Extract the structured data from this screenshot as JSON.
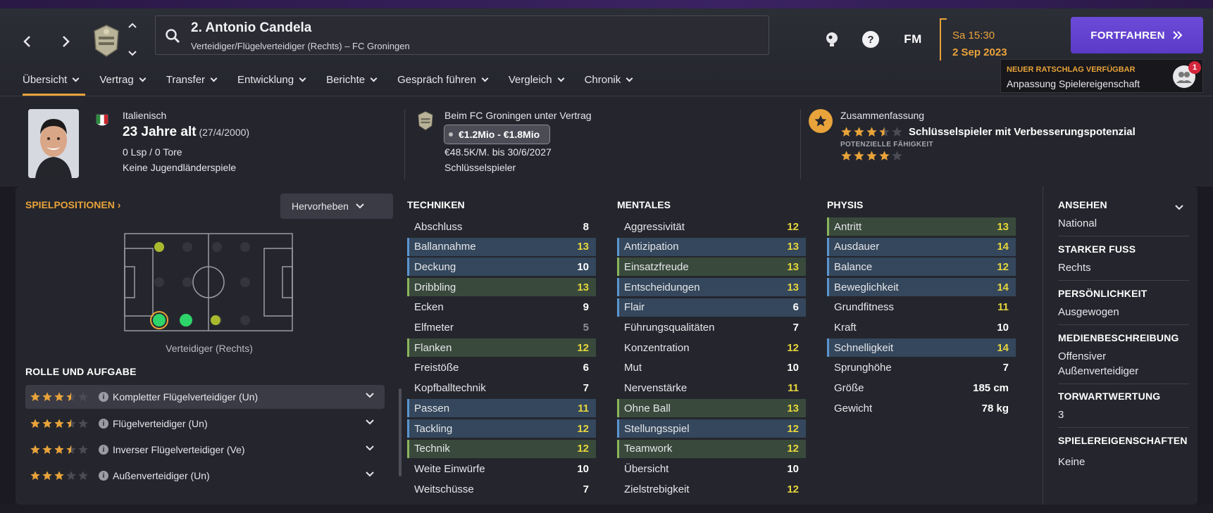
{
  "header": {
    "player_title": "2. Antonio Candela",
    "player_subtitle": "Verteidiger/Flügelverteidiger (Rechts) – FC Groningen",
    "fm_logo": "FM",
    "date_time": "Sa 15:30",
    "date_day": "2 Sep 2023",
    "continue_label": "FORTFAHREN",
    "accent_color": "#e8a33a",
    "button_color": "#6c4bd8"
  },
  "tabs": [
    {
      "label": "Übersicht"
    },
    {
      "label": "Vertrag"
    },
    {
      "label": "Transfer"
    },
    {
      "label": "Entwicklung"
    },
    {
      "label": "Berichte"
    },
    {
      "label": "Gespräch führen"
    },
    {
      "label": "Vergleich"
    },
    {
      "label": "Chronik"
    }
  ],
  "advice": {
    "title": "NEUER RATSCHLAG VERFÜGBAR",
    "text": "Anpassung Spielereigenschaft",
    "badge_count": "1"
  },
  "summary": {
    "nationality": "Italienisch",
    "age": "23 Jahre alt",
    "birthdate": "(27/4/2000)",
    "caps": "0 Lsp / 0 Tore",
    "youth_caps": "Keine Jugendländerspiele",
    "contract_club": "Beim FC Groningen unter Vertrag",
    "value_range": "€1.2Mio - €1.8Mio",
    "wage": "€48.5K/M. bis 30/6/2027",
    "squad_status": "Schlüsselspieler",
    "summary_label": "Zusammenfassung",
    "summary_text": "Schlüsselspieler mit Verbesserungspotenzial",
    "current_ability_stars": 3.5,
    "potential_label": "POTENZIELLE FÄHIGKEIT",
    "potential_stars": 4
  },
  "positions": {
    "title": "SPIELPOSITIONEN",
    "highlight_label": "Hervorheben",
    "position_label": "Verteidiger (Rechts)"
  },
  "roles": {
    "title": "ROLLE UND AUFGABE",
    "items": [
      {
        "stars": 3.5,
        "name": "Kompletter Flügelverteidiger (Un)"
      },
      {
        "stars": 3.5,
        "name": "Flügelverteidiger (Un)"
      },
      {
        "stars": 3.5,
        "name": "Inverser Flügelverteidiger (Ve)"
      },
      {
        "stars": 3,
        "name": "Außenverteidiger (Un)"
      }
    ]
  },
  "technical": {
    "title": "TECHNIKEN",
    "rows": [
      {
        "name": "Abschluss",
        "value": "8"
      },
      {
        "name": "Ballannahme",
        "value": "13"
      },
      {
        "name": "Deckung",
        "value": "10"
      },
      {
        "name": "Dribbling",
        "value": "13"
      },
      {
        "name": "Ecken",
        "value": "9"
      },
      {
        "name": "Elfmeter",
        "value": "5"
      },
      {
        "name": "Flanken",
        "value": "12"
      },
      {
        "name": "Freistöße",
        "value": "6"
      },
      {
        "name": "Kopfballtechnik",
        "value": "7"
      },
      {
        "name": "Passen",
        "value": "11"
      },
      {
        "name": "Tackling",
        "value": "12"
      },
      {
        "name": "Technik",
        "value": "12"
      },
      {
        "name": "Weite Einwürfe",
        "value": "10"
      },
      {
        "name": "Weitschüsse",
        "value": "7"
      }
    ]
  },
  "mental": {
    "title": "MENTALES",
    "rows": [
      {
        "name": "Aggressivität",
        "value": "12"
      },
      {
        "name": "Antizipation",
        "value": "13"
      },
      {
        "name": "Einsatzfreude",
        "value": "13"
      },
      {
        "name": "Entscheidungen",
        "value": "13"
      },
      {
        "name": "Flair",
        "value": "6"
      },
      {
        "name": "Führungsqualitäten",
        "value": "7"
      },
      {
        "name": "Konzentration",
        "value": "12"
      },
      {
        "name": "Mut",
        "value": "10"
      },
      {
        "name": "Nervenstärke",
        "value": "11"
      },
      {
        "name": "Ohne Ball",
        "value": "13"
      },
      {
        "name": "Stellungsspiel",
        "value": "12"
      },
      {
        "name": "Teamwork",
        "value": "12"
      },
      {
        "name": "Übersicht",
        "value": "10"
      },
      {
        "name": "Zielstrebigkeit",
        "value": "12"
      }
    ]
  },
  "physical": {
    "title": "PHYSIS",
    "rows": [
      {
        "name": "Antritt",
        "value": "13"
      },
      {
        "name": "Ausdauer",
        "value": "14"
      },
      {
        "name": "Balance",
        "value": "12"
      },
      {
        "name": "Beweglichkeit",
        "value": "14"
      },
      {
        "name": "Grundfitness",
        "value": "11"
      },
      {
        "name": "Kraft",
        "value": "10"
      },
      {
        "name": "Schnelligkeit",
        "value": "14"
      },
      {
        "name": "Sprunghöhe",
        "value": "7"
      },
      {
        "name": "Größe",
        "value": "185 cm"
      },
      {
        "name": "Gewicht",
        "value": "78 kg"
      }
    ]
  },
  "info": {
    "reputation_h": "ANSEHEN",
    "reputation_v": "National",
    "foot_h": "STARKER FUSS",
    "foot_v": "Rechts",
    "personality_h": "PERSÖNLICHKEIT",
    "personality_v": "Ausgewogen",
    "media_h": "MEDIENBESCHREIBUNG",
    "media_v": "Offensiver Außenverteidiger",
    "gk_h": "TORWARTWERTUNG",
    "gk_v": "3",
    "traits_h": "SPIELEREIGENSCHAFTEN",
    "traits_v": "Keine"
  }
}
